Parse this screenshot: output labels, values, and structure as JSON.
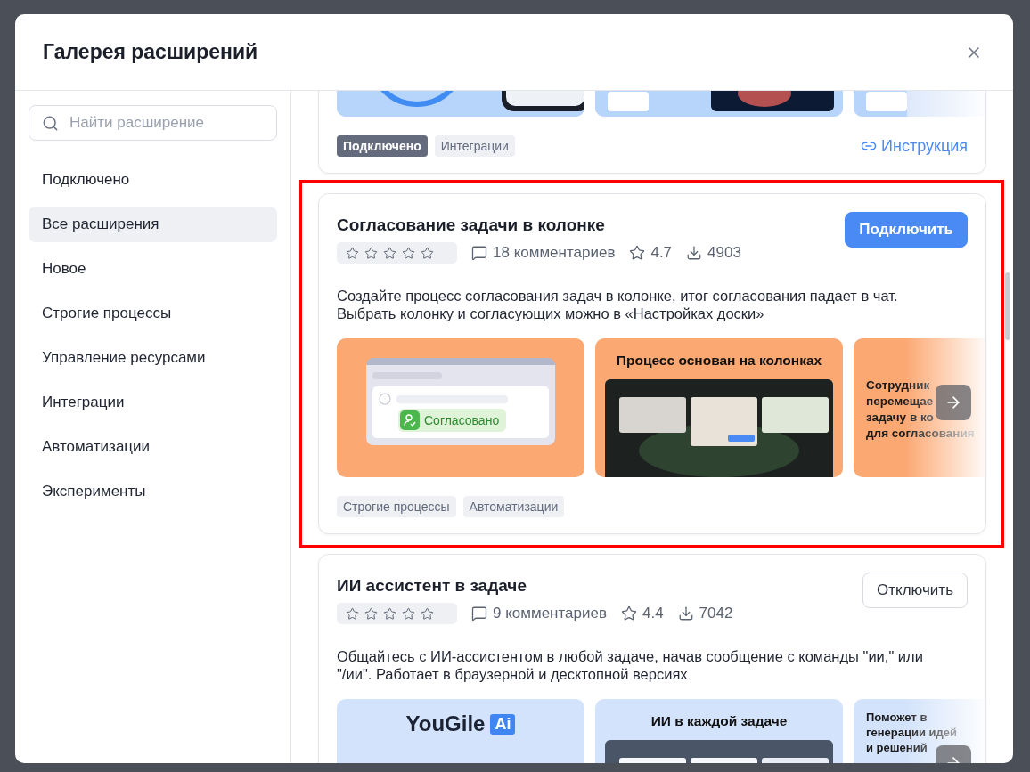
{
  "dialog": {
    "title": "Галерея расширений"
  },
  "search": {
    "placeholder": "Найти расширение"
  },
  "categories": [
    {
      "label": "Подключено",
      "selected": false
    },
    {
      "label": "Все расширения",
      "selected": true
    },
    {
      "label": "Новое",
      "selected": false
    },
    {
      "label": "Строгие процессы",
      "selected": false
    },
    {
      "label": "Управление ресурсами",
      "selected": false
    },
    {
      "label": "Интеграции",
      "selected": false
    },
    {
      "label": "Автоматизации",
      "selected": false
    },
    {
      "label": "Эксперименты",
      "selected": false
    }
  ],
  "extensions": [
    {
      "slides": [
        {
          "kind": "picture"
        },
        {
          "kind": "picture"
        },
        {
          "kind": "picture"
        }
      ],
      "tags": [
        {
          "label": "Подключено",
          "kind": "status"
        },
        {
          "label": "Интеграции",
          "kind": "category"
        }
      ],
      "link": "Инструкция"
    },
    {
      "highlighted": true,
      "title": "Согласование задачи в колонке",
      "stars": 0,
      "comments": "18 комментариев",
      "rating": "4.7",
      "downloads": "4903",
      "action": {
        "label": "Подключить",
        "kind": "primary"
      },
      "description": "Создайте процесс согласования задач в колонке, итог согласования падает в чат. Выбрать колонку и согласующих можно в «Настройках доски»",
      "color": "#fca873",
      "next_button": true,
      "slides": [
        {
          "kind": "approval",
          "chip": "Согласовано"
        },
        {
          "kind": "screenshot",
          "title": "Процесс основан на колонках"
        },
        {
          "kind": "text",
          "lines": [
            "Сотрудник",
            "перемещае",
            "задачу в ко",
            "для согласования"
          ]
        }
      ],
      "tags": [
        {
          "label": "Строгие процессы",
          "kind": "category"
        },
        {
          "label": "Автоматизации",
          "kind": "category"
        }
      ]
    },
    {
      "title": "ИИ ассистент в задаче",
      "stars": 0,
      "comments": "9 комментариев",
      "rating": "4.4",
      "downloads": "7042",
      "action": {
        "label": "Отключить",
        "kind": "secondary"
      },
      "description": "Общайтесь с ИИ-ассистентом в любой задаче, начав сообщение с команды \"ии,\" или \"/ии\". Работает в браузерной и десктопной версиях",
      "color": "#d3e3fb",
      "next_button": true,
      "slides": [
        {
          "kind": "logo",
          "logo": "YouGile",
          "badge": "Ai"
        },
        {
          "kind": "screenshot",
          "title": "ИИ в каждой задаче"
        },
        {
          "kind": "text",
          "lines": [
            "Поможет в",
            "генерации идей",
            "и решений"
          ]
        }
      ]
    }
  ]
}
